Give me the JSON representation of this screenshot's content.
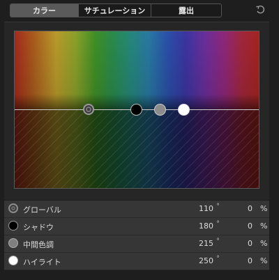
{
  "tabs": [
    {
      "label": "カラー",
      "active": true
    },
    {
      "label": "サチュレーション",
      "active": false
    },
    {
      "label": "露出",
      "active": false
    }
  ],
  "reset_icon": "undo-arrow-icon",
  "board": {
    "pucks": [
      {
        "name": "global-puck",
        "hue": 110
      },
      {
        "name": "shadows-puck",
        "hue": 180
      },
      {
        "name": "midtones-puck",
        "hue": 215
      },
      {
        "name": "highlights-puck",
        "hue": 250
      }
    ]
  },
  "rows": [
    {
      "name": "グローバル",
      "degrees": "110",
      "deg_symbol": "°",
      "percent": "0",
      "pct_symbol": "%",
      "icon": "global-ring-icon"
    },
    {
      "name": "シャドウ",
      "degrees": "180",
      "deg_symbol": "°",
      "percent": "0",
      "pct_symbol": "%",
      "icon": "black-circle-icon"
    },
    {
      "name": "中間色調",
      "degrees": "215",
      "deg_symbol": "°",
      "percent": "0",
      "pct_symbol": "%",
      "icon": "gray-circle-icon"
    },
    {
      "name": "ハイライト",
      "degrees": "250",
      "deg_symbol": "°",
      "percent": "0",
      "pct_symbol": "%",
      "icon": "white-circle-icon"
    }
  ]
}
